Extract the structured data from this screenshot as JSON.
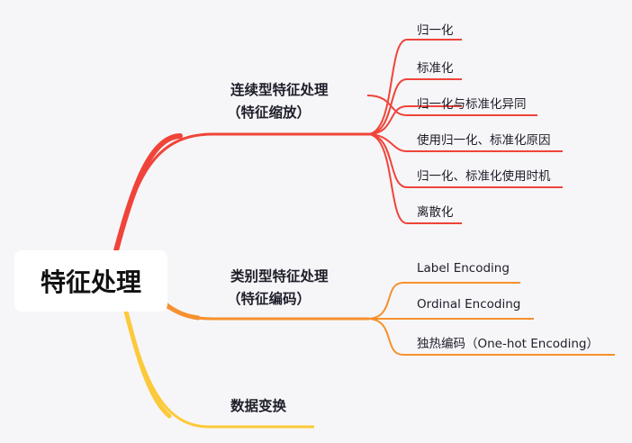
{
  "colors": {
    "continuous": "#f0443a",
    "categorical": "#f7902f",
    "transform": "#fcc93a",
    "background": "#f6f6f8"
  },
  "root": {
    "label": "特征处理"
  },
  "branches": [
    {
      "label_line1": "连续型特征处理",
      "label_line2": "（特征缩放）",
      "leaves": [
        "归一化",
        "标准化",
        "归一化与标准化异同",
        "使用归一化、标准化原因",
        "归一化、标准化使用时机",
        "离散化"
      ]
    },
    {
      "label_line1": "类别型特征处理",
      "label_line2": "（特征编码）",
      "leaves": [
        "Label Encoding",
        "Ordinal Encoding",
        "独热编码（One-hot Encoding）"
      ]
    },
    {
      "label_line1": "数据变换"
    }
  ]
}
